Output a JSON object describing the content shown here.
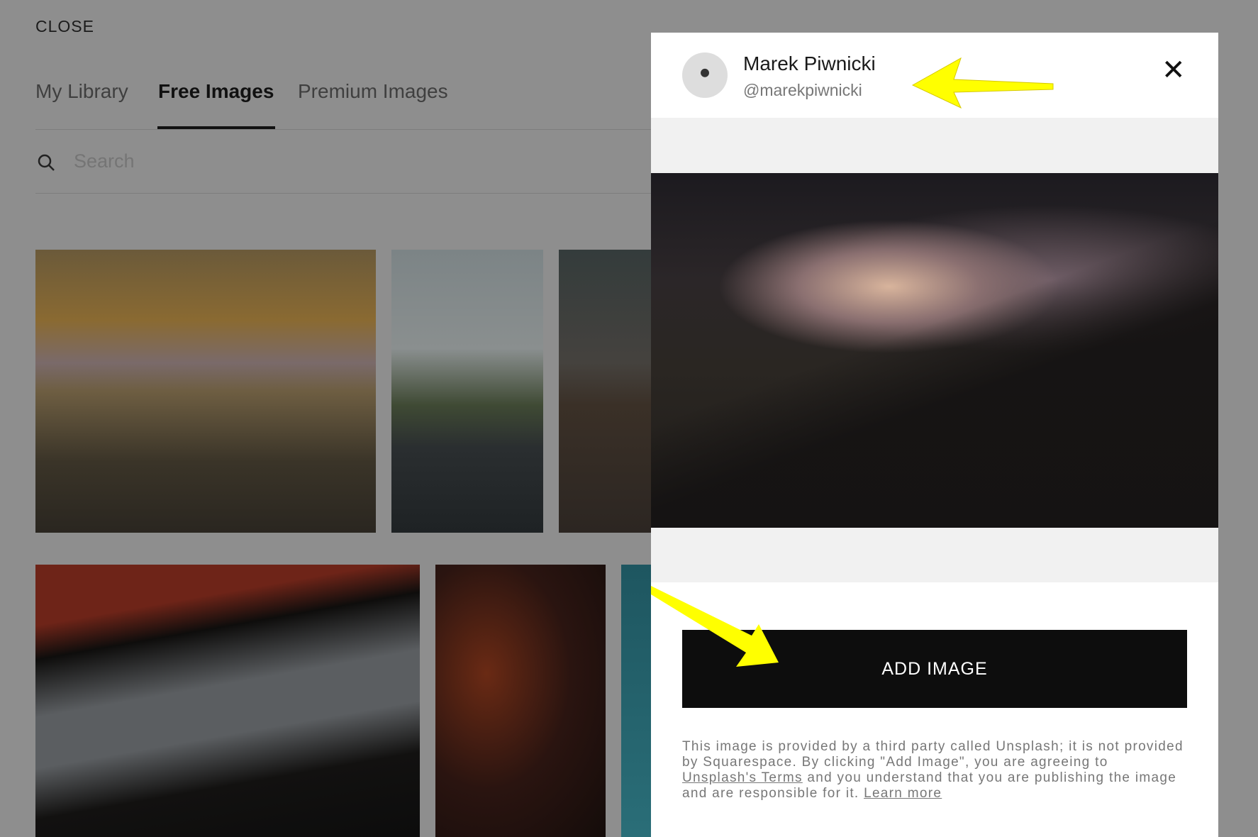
{
  "close_label": "CLOSE",
  "tabs": [
    {
      "label": "My Library"
    },
    {
      "label": "Free Images"
    },
    {
      "label": "Premium Images"
    }
  ],
  "active_tab": "Free Images",
  "search": {
    "placeholder": "Search"
  },
  "panel": {
    "author_name": "Marek Piwnicki",
    "author_handle": "@marekpiwnicki",
    "add_button": "ADD IMAGE",
    "disclaimer_1": "This image is provided by a third party called Unsplash; it is not provided by Squarespace. By clicking \"Add Image\", you are agreeing to ",
    "terms_link": "Unsplash's Terms",
    "disclaimer_2": " and you understand that you are publishing the image and are responsible for it. ",
    "learn_more": "Learn more"
  },
  "colors": {
    "overlay": "#8e8e8e",
    "button": "#0d0d0d",
    "annotation_arrow": "#ffff00"
  }
}
